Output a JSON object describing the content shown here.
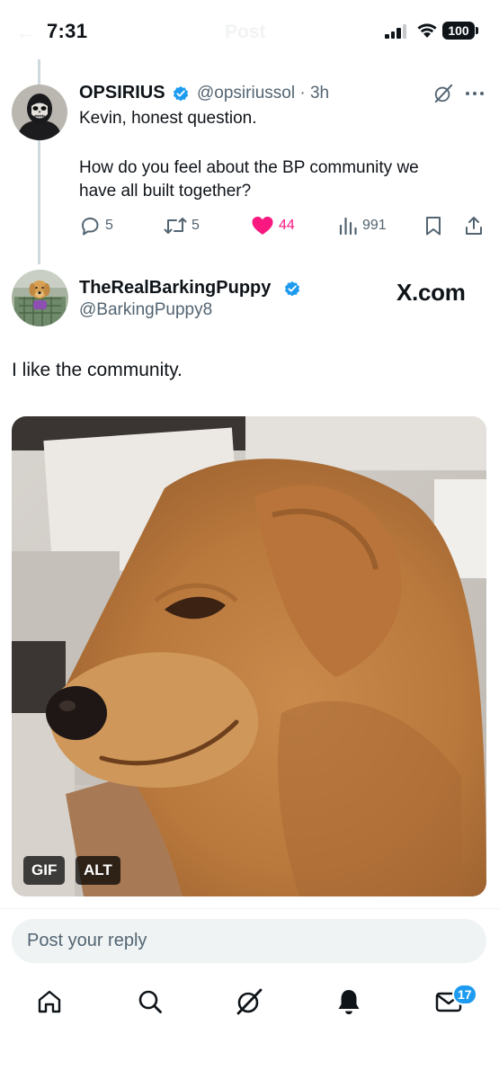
{
  "status_bar": {
    "time": "7:31",
    "battery": "100",
    "header_title": "Post"
  },
  "parent_tweet": {
    "author_name": "OPSIRIUS",
    "handle": "@opsiriussol",
    "time": "3h",
    "text_line1": "Kevin, honest question.",
    "text_line2": "How do you feel about the BP community we",
    "text_line3": "have all built together?",
    "actions": {
      "replies": "5",
      "reposts": "5",
      "likes": "44",
      "views": "991"
    },
    "liked": true,
    "verified": true
  },
  "reply_tweet": {
    "author_name": "TheRealBarkingPuppy",
    "handle": "@BarkingPuppy8",
    "verified": true,
    "source_logo": "X.com",
    "text": "I like the community.",
    "media": {
      "type": "gif",
      "badge_gif": "GIF",
      "badge_alt": "ALT"
    }
  },
  "composer": {
    "placeholder": "Post your reply"
  },
  "tab_bar": {
    "items": [
      "home-icon",
      "search-icon",
      "grok-icon",
      "notifications-icon",
      "messages-icon"
    ],
    "messages_badge": "17"
  },
  "colors": {
    "accent": "#1d9bf0",
    "like": "#f91880",
    "secondary_text": "#536471"
  }
}
